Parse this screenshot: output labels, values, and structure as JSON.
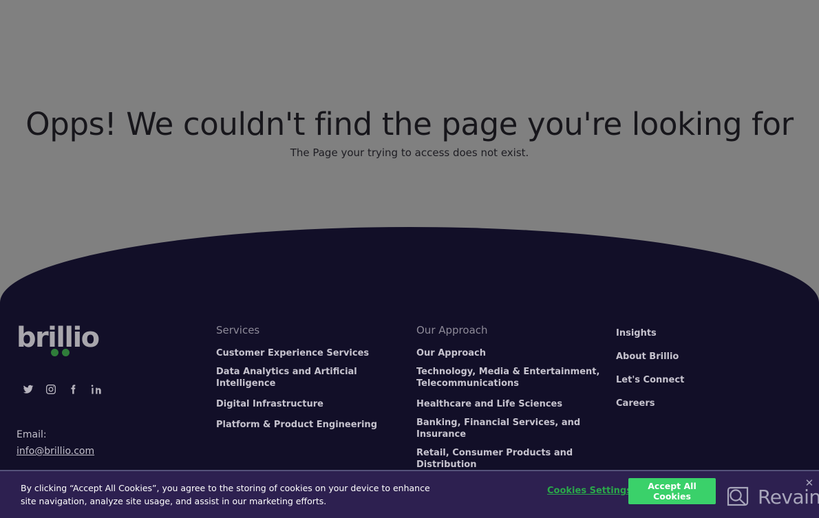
{
  "page": {
    "background_color": "#808080",
    "footer_color": "#120f28",
    "accent_green": "#3ad16a"
  },
  "error": {
    "title": "Opps! We couldn't find the page you're looking for",
    "subtitle": "The Page your trying to access does not exist."
  },
  "footer": {
    "brand": {
      "wordmark": "brillio",
      "dot_color": "#2f7d3a"
    },
    "social": [
      {
        "name": "twitter-icon",
        "label": "Twitter"
      },
      {
        "name": "instagram-icon",
        "label": "Instagram"
      },
      {
        "name": "facebook-icon",
        "label": "Facebook"
      },
      {
        "name": "linkedin-icon",
        "label": "LinkedIn"
      }
    ],
    "email": {
      "label": "Email:",
      "address": "info@brillio.com"
    },
    "columns": [
      {
        "heading": "Services",
        "links": [
          "Customer Experience Services",
          "Data Analytics and Artificial Intelligence",
          "Digital Infrastructure",
          "Platform & Product Engineering"
        ]
      },
      {
        "heading": "Our Approach",
        "links": [
          "Our Approach",
          "Technology, Media & Entertainment, Telecommunications",
          "Healthcare and Life Sciences",
          "Banking, Financial Services, and Insurance",
          "Retail, Consumer Products and Distribution"
        ]
      },
      {
        "heading": "",
        "links": [
          "Insights",
          "About Brillio",
          "Let's Connect",
          "Careers"
        ]
      }
    ]
  },
  "cookie_banner": {
    "text": "By clicking “Accept All Cookies”, you agree to the storing of cookies on your device to enhance site navigation, analyze site usage, and assist in our marketing efforts.",
    "settings_label": "Cookies Settings",
    "accept_label": "Accept All Cookies"
  },
  "watermark": {
    "text": "Revain"
  }
}
